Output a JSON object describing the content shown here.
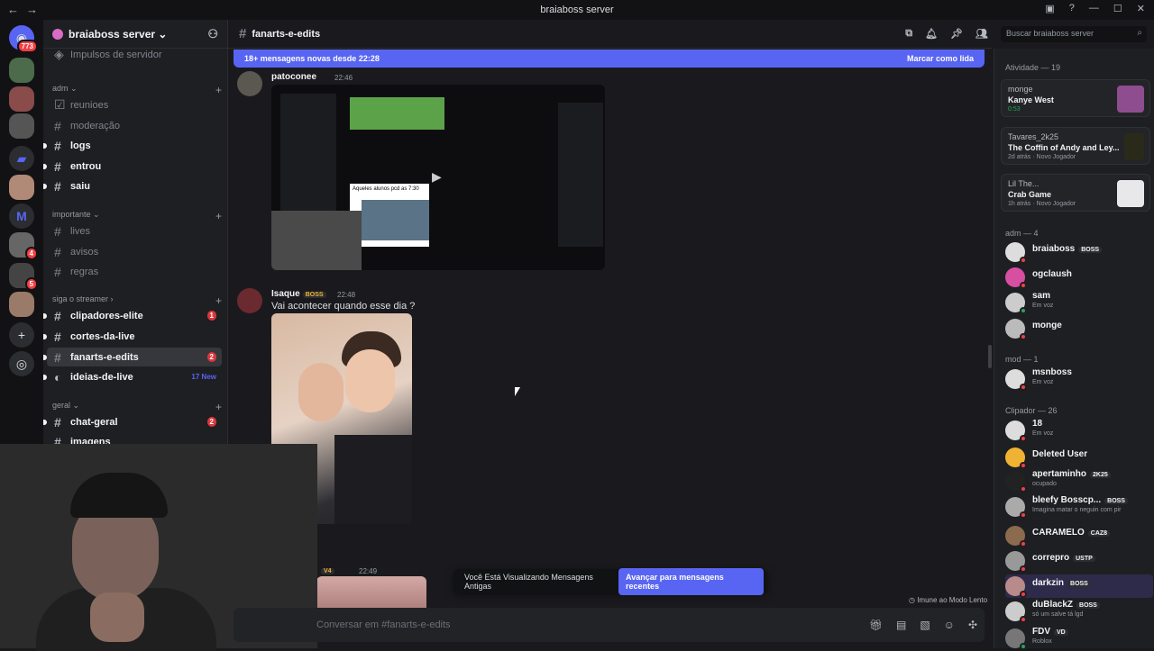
{
  "window": {
    "title": "braiaboss server"
  },
  "guilds": {
    "home_badge": "773",
    "badge_4": "4",
    "badge_5": "5"
  },
  "server": {
    "name": "braiaboss server",
    "boost_label": "Impulsos de servidor"
  },
  "categories": {
    "adm": "adm",
    "importante": "importante",
    "siga": "siga o streamer",
    "geral": "geral"
  },
  "channels": [
    {
      "name": "reunioes"
    },
    {
      "name": "moderação"
    },
    {
      "name": "logs"
    },
    {
      "name": "entrou"
    },
    {
      "name": "saiu"
    },
    {
      "name": "lives"
    },
    {
      "name": "avisos"
    },
    {
      "name": "regras"
    },
    {
      "name": "clipadores-elite",
      "count": "1"
    },
    {
      "name": "cortes-da-live"
    },
    {
      "name": "fanarts-e-edits",
      "count": "2"
    },
    {
      "name": "ideias-de-live",
      "new": "17 New"
    },
    {
      "name": "chat-geral",
      "count": "2"
    },
    {
      "name": "imagens"
    }
  ],
  "chat": {
    "channel": "fanarts-e-edits",
    "new_messages": "18+ mensagens novas desde 22:28",
    "mark_read": "Marcar como lida",
    "search_placeholder": "Buscar braiaboss server",
    "composer_placeholder": "Conversar em #fanarts-e-edits",
    "old_messages": "Você Está Visualizando Mensagens Antigas",
    "jump_button": "Avançar para mensagens recentes",
    "slowmode": "Imune ao Modo Lento"
  },
  "messages": [
    {
      "author": "patoconee",
      "time": "22:46",
      "embed_caption": "Aqueles alunos pcd as 7:30"
    },
    {
      "author": "Isaque",
      "tag": "BOSS",
      "time": "22:48",
      "text": "Vai acontecer quando esse dia ?"
    },
    {
      "tag": "V4",
      "time": "22:49"
    }
  ],
  "members": {
    "activity_header": "Atividade — 19",
    "activities": [
      {
        "who": "monge",
        "what": "Kanye West",
        "sub": "0:53"
      },
      {
        "who": "Tavares_2k25",
        "what": "The Coffin of Andy and Ley...",
        "sub": "2d atrás · Novo Jogador"
      },
      {
        "who": "Lil The...",
        "what": "Crab Game",
        "sub": "1h atrás · Novo Jogador"
      }
    ],
    "groups": [
      {
        "header": "adm — 4",
        "list": [
          {
            "name": "braiaboss",
            "tag": "BOSS"
          },
          {
            "name": "ogclaush"
          },
          {
            "name": "sam",
            "status": "Em voz"
          },
          {
            "name": "monge"
          }
        ]
      },
      {
        "header": "mod — 1",
        "list": [
          {
            "name": "msnboss",
            "status": "Em voz"
          }
        ]
      },
      {
        "header": "Clipador — 26",
        "list": [
          {
            "name": "18",
            "status": "Em voz"
          },
          {
            "name": "Deleted User"
          },
          {
            "name": "apertaminho",
            "tag": "2K25",
            "status": "ocupado"
          },
          {
            "name": "bleefy Bosscp...",
            "tag": "BOSS",
            "status": "Imagina matar o neguin com pir"
          },
          {
            "name": "CARAMELO",
            "tag": "CAZ8"
          },
          {
            "name": "correpro",
            "tag": "USTP"
          },
          {
            "name": "darkzin",
            "tag": "BOSS"
          },
          {
            "name": "duBlackZ",
            "tag": "BOSS",
            "status": "só um salve tá lgd"
          },
          {
            "name": "FDV",
            "tag": "VD",
            "status": "Roblox"
          }
        ]
      }
    ]
  }
}
